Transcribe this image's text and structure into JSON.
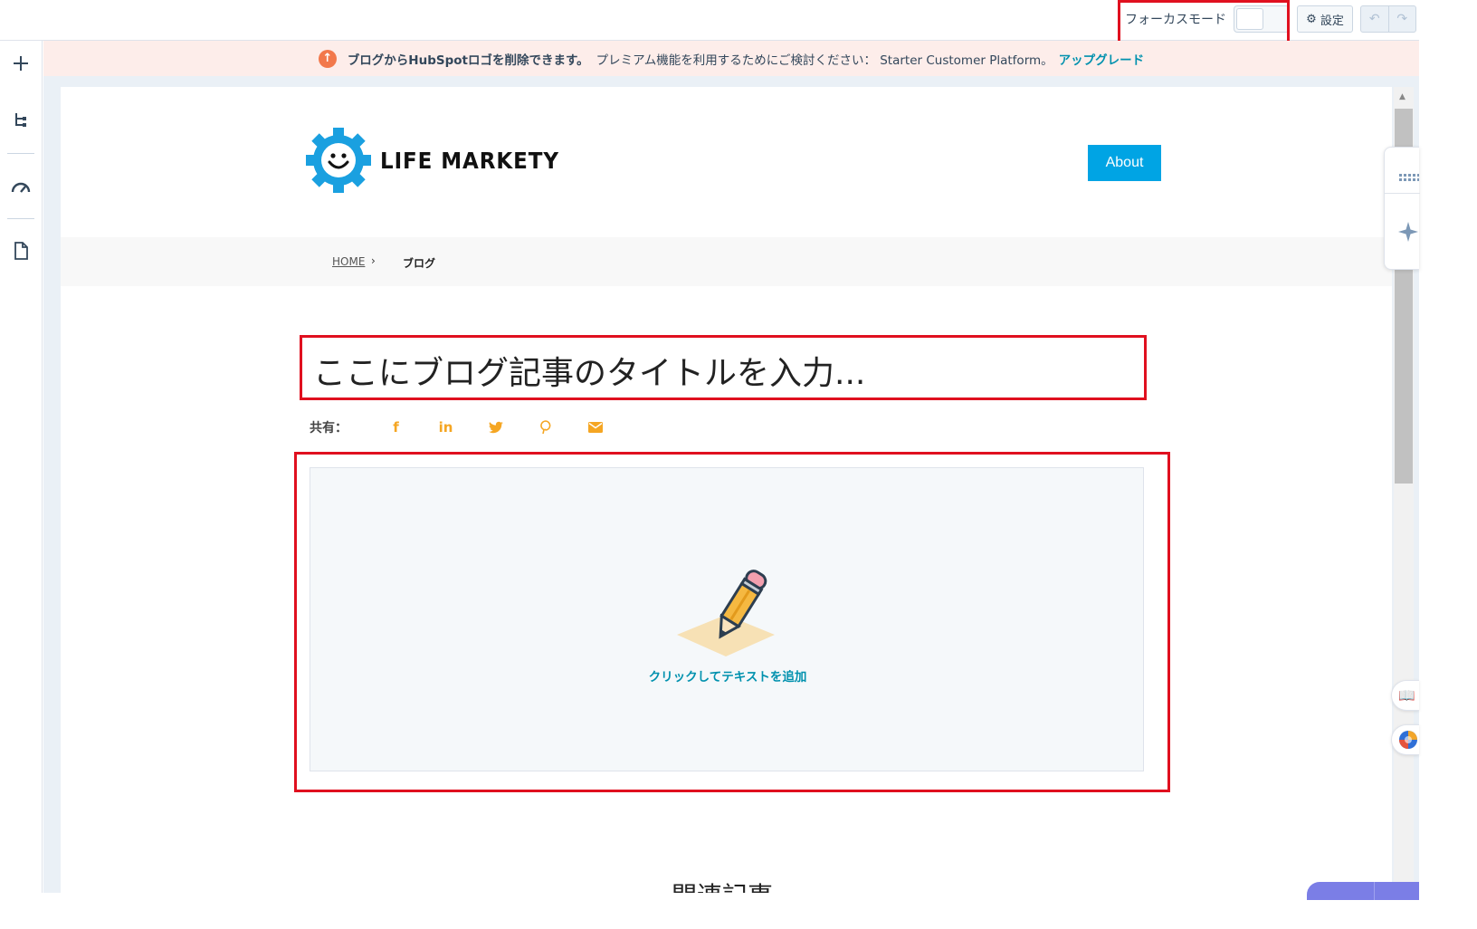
{
  "topbar": {
    "focus_mode_label": "フォーカスモード",
    "settings_label": "設定"
  },
  "banner": {
    "text_bold": "ブログからHubSpotロゴを削除できます。",
    "text": "プレミアム機能を利用するためにご検討ください： Starter Customer Platform。",
    "link": "アップグレード"
  },
  "site": {
    "logo_text": "LIFE MARKETY",
    "nav_about": "About"
  },
  "breadcrumb": {
    "home": "HOME",
    "separator": "›",
    "current": "ブログ"
  },
  "post": {
    "title_placeholder": "ここにブログ記事のタイトルを入力...",
    "share_label": "共有：",
    "add_text": "クリックしてテキストを追加",
    "related_heading": "関連記事"
  },
  "share_icons": [
    "facebook-icon",
    "linkedin-icon",
    "twitter-icon",
    "pinterest-icon",
    "email-icon"
  ],
  "colors": {
    "highlight": "#e0101f",
    "about_button": "#00a4e4",
    "share_icon": "#f5a623",
    "link": "#0091ae",
    "banner_bg": "#fdedea"
  }
}
